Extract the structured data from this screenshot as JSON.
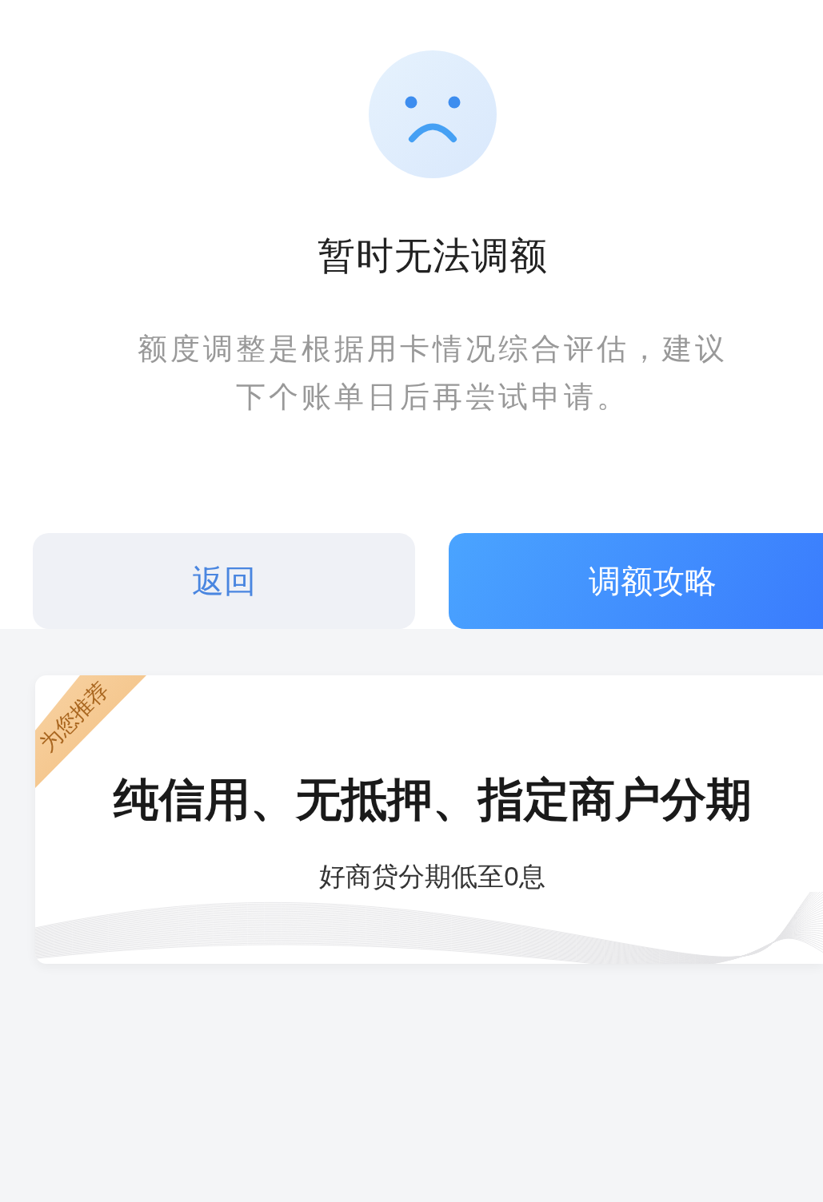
{
  "result": {
    "title": "暂时无法调额",
    "message": "额度调整是根据用卡情况综合评估，建议下个账单日后再尝试申请。"
  },
  "buttons": [
    {
      "label": "返回",
      "kind": "secondary"
    },
    {
      "label": "调额攻略",
      "kind": "primary"
    }
  ],
  "promo_card": {
    "ribbon": "为您推荐",
    "headline": "纯信用、无抵押、指定商户分期",
    "subtitle": "好商贷分期低至0息"
  }
}
